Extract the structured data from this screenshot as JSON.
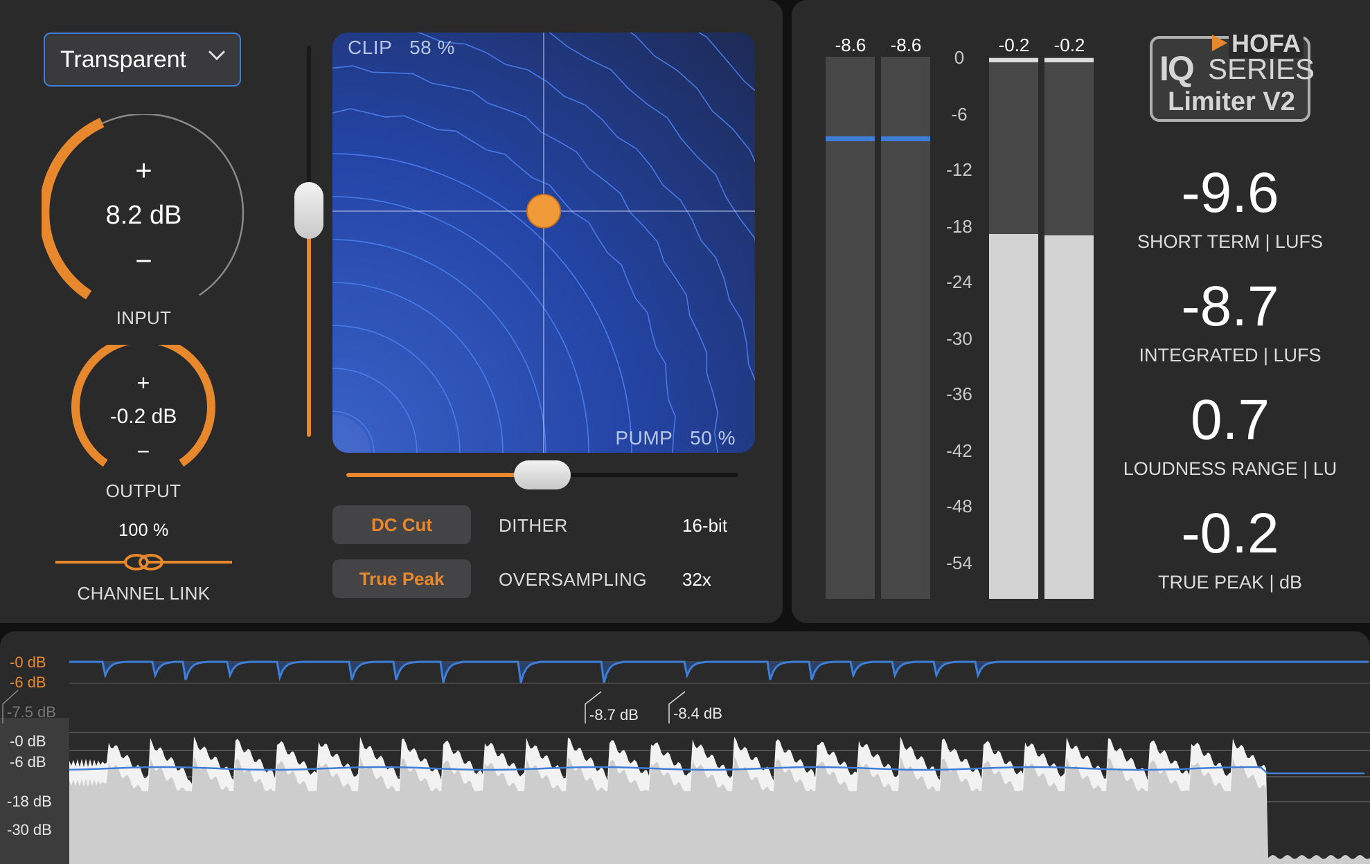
{
  "preset": {
    "label": "Transparent"
  },
  "input": {
    "value": "8.2 dB",
    "label": "INPUT",
    "plus": "+",
    "minus": "−",
    "level": 0.5
  },
  "output": {
    "value": "-0.2 dB",
    "label": "OUTPUT",
    "plus": "+",
    "minus": "−",
    "level": 0.98
  },
  "channel_link": {
    "value": "100 %",
    "label": "CHANNEL LINK"
  },
  "xy_pad": {
    "clip_label": "CLIP",
    "clip_value": "58 %",
    "pump_label": "PUMP",
    "pump_value": "50 %"
  },
  "options": {
    "dc_cut": "DC Cut",
    "true_peak": "True Peak",
    "dither_label": "DITHER",
    "dither_value": "16-bit",
    "oversampling_label": "OVERSAMPLING",
    "oversampling_value": "32x"
  },
  "meters": {
    "input_values": [
      "-8.6",
      "-8.6"
    ],
    "output_values": [
      "-0.2",
      "-0.2"
    ],
    "scale": [
      "0",
      "-6",
      "-12",
      "-18",
      "-24",
      "-30",
      "-36",
      "-42",
      "-48",
      "-54"
    ]
  },
  "logo": {
    "brand": "HOFA",
    "iq": "IQ",
    "series": "SERIES",
    "product": "Limiter V2"
  },
  "loudness": {
    "short_term": {
      "value": "-9.6",
      "label": "SHORT TERM | LUFS"
    },
    "integrated": {
      "value": "-8.7",
      "label": "INTEGRATED | LUFS"
    },
    "range": {
      "value": "0.7",
      "label": "LOUDNESS RANGE | LU"
    },
    "true_peak": {
      "value": "-0.2",
      "label": "TRUE PEAK | dB"
    }
  },
  "history": {
    "gr_labels": [
      "-0 dB",
      "-6 dB",
      "-7.5 dB"
    ],
    "level_labels": [
      "-0 dB",
      "-6 dB",
      "-18 dB",
      "-30 dB"
    ],
    "markers": [
      "-8.7 dB",
      "-8.4 dB"
    ]
  },
  "colors": {
    "accent": "#e8882c",
    "blue": "#3d7fd8",
    "panel": "#2a2a2b"
  }
}
